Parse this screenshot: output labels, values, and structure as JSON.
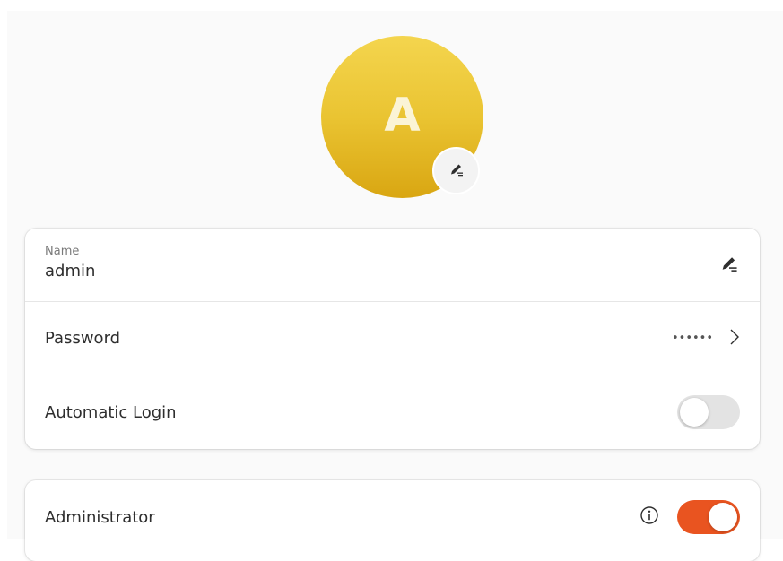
{
  "avatar": {
    "initial": "A",
    "color_top": "#f4d54e",
    "color_bottom": "#d9a612",
    "edit_icon": "pencil-icon"
  },
  "account": {
    "name_label": "Name",
    "name_value": "admin",
    "name_edit_icon": "pencil-icon",
    "password_label": "Password",
    "password_dots": "••••••",
    "password_chevron_icon": "chevron-right-icon",
    "autologin_label": "Automatic Login",
    "autologin_enabled": false
  },
  "admin": {
    "label": "Administrator",
    "info_icon": "info-icon",
    "enabled": true,
    "accent_color": "#e95420"
  }
}
